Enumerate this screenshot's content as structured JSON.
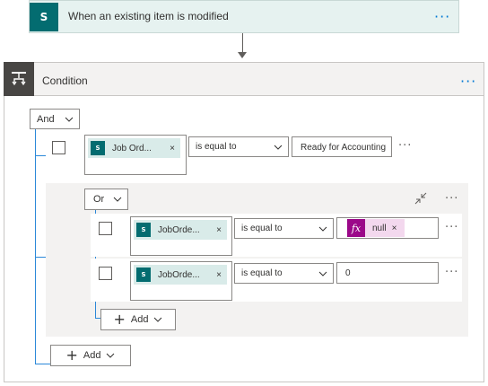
{
  "trigger": {
    "title": "When an existing item is modified",
    "icon": "sharepoint-icon",
    "menu": "···"
  },
  "condition": {
    "title": "Condition",
    "icon": "condition-icon",
    "menu": "···",
    "operator": "And",
    "rows": [
      {
        "left_token": "Job Ord...",
        "comparison": "is equal to",
        "right_value": "Ready for Accounting",
        "menu": "···"
      }
    ],
    "group": {
      "operator": "Or",
      "collapse_icon": "collapse-icon",
      "menu": "···",
      "rows": [
        {
          "left_token": "JobOrde...",
          "comparison": "is equal to",
          "right_expression": "null",
          "menu": "···"
        },
        {
          "left_token": "JobOrde...",
          "comparison": "is equal to",
          "right_value": "0",
          "menu": "···"
        }
      ],
      "add_label": "Add"
    },
    "add_label": "Add"
  },
  "colors": {
    "sharepoint": "#036c70",
    "token_bg": "#d9ebe9",
    "expression": "#9b0889",
    "expression_bg": "#f3d8ee",
    "accent": "#0078d4",
    "connector_line": "#2b88d8"
  },
  "glyphs": {
    "remove": "×",
    "plus": "+",
    "sp": "S",
    "fx": "fx"
  }
}
